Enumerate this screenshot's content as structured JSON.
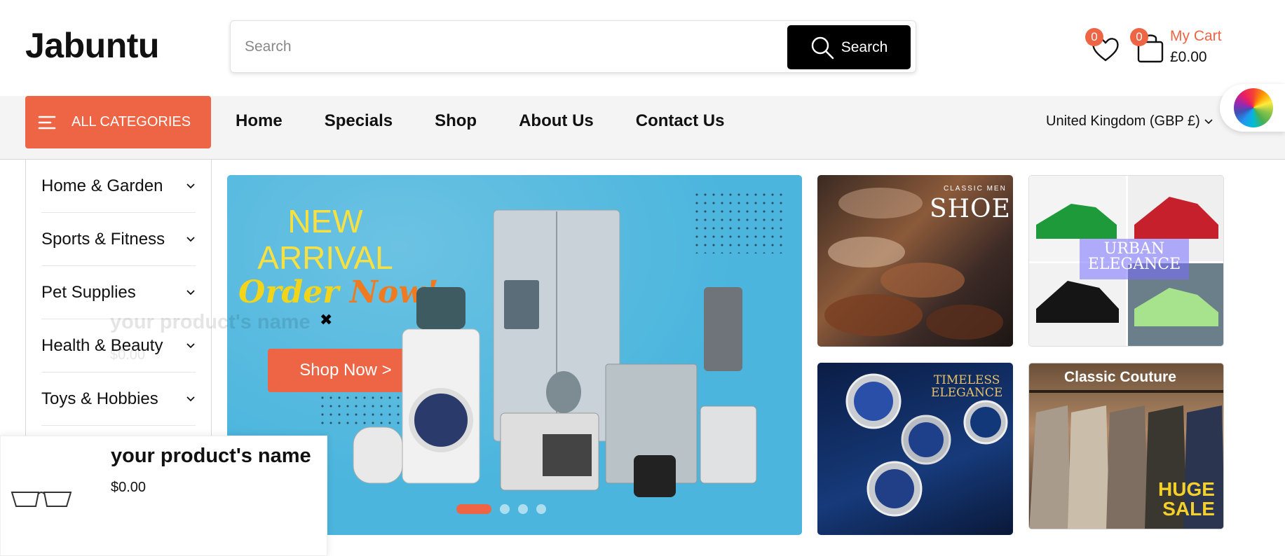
{
  "header": {
    "logo": "Jabuntu",
    "search_placeholder": "Search",
    "search_button": "Search",
    "wishlist_count": "0",
    "cart_count": "0",
    "cart_label": "My Cart",
    "cart_total": "£0.00"
  },
  "nav": {
    "all_categories": "ALL CATEGORIES",
    "links": [
      "Home",
      "Specials",
      "Shop",
      "About Us",
      "Contact Us"
    ],
    "currency": "United Kingdom (GBP £)"
  },
  "sidebar": {
    "items": [
      {
        "label": "Home & Garden"
      },
      {
        "label": "Sports & Fitness"
      },
      {
        "label": "Pet Supplies"
      },
      {
        "label": "Health & Beauty"
      },
      {
        "label": "Toys & Hobbies"
      }
    ]
  },
  "banner": {
    "line1": "NEW",
    "line2": "ARRIVAL",
    "order": "Order",
    "now": "Now!",
    "cta": "Shop Now >",
    "slides_total": 4,
    "active_slide": 1
  },
  "tiles": {
    "shoe_small": "CLASSIC MEN",
    "shoe_big": "SHOE",
    "urban_1": "URBAN",
    "urban_2": "ELEGANCE",
    "watch_1": "TIMELESS",
    "watch_2": "ELEGANCE",
    "couture": "Classic Couture",
    "huge": "HUGE",
    "sale": "SALE"
  },
  "popup": {
    "product_name": "your product's name",
    "price": "$0.00",
    "close": "✖"
  },
  "colors": {
    "accent": "#ee6545",
    "banner_bg": "#4bb5dd"
  }
}
